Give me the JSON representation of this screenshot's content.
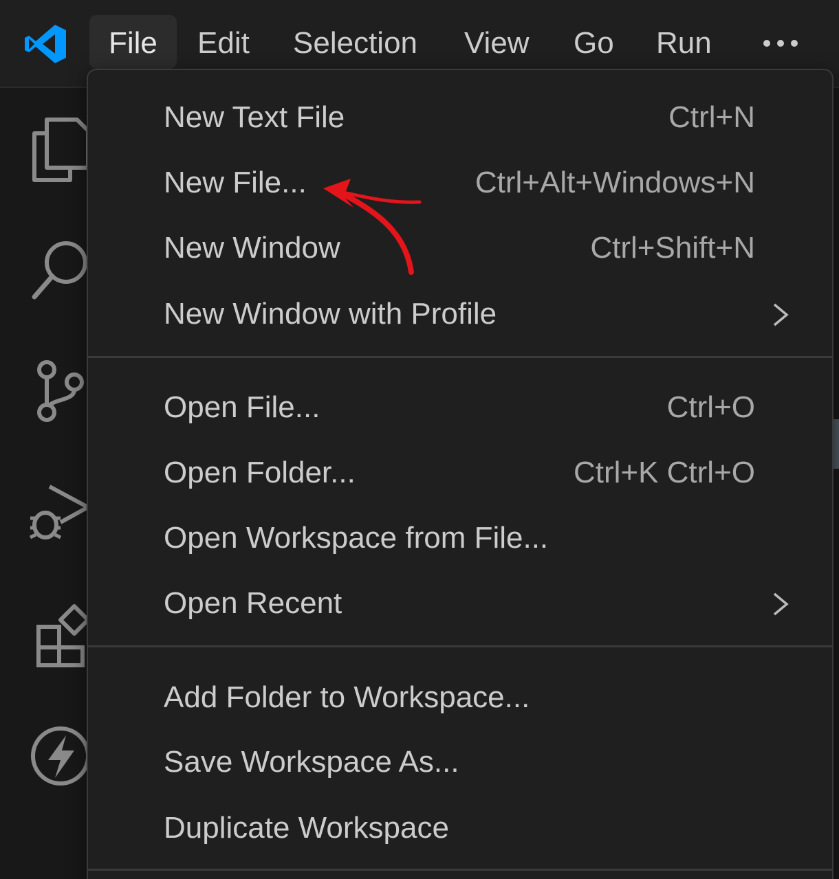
{
  "menubar": {
    "items": [
      {
        "label": "File"
      },
      {
        "label": "Edit"
      },
      {
        "label": "Selection"
      },
      {
        "label": "View"
      },
      {
        "label": "Go"
      },
      {
        "label": "Run"
      }
    ],
    "active": "File",
    "accent_color": "#0098ff"
  },
  "activity_bar": {
    "icons": [
      "explorer-icon",
      "search-icon",
      "source-control-icon",
      "run-debug-icon",
      "extensions-icon",
      "thunder-client-icon"
    ]
  },
  "file_menu": {
    "groups": [
      {
        "items": [
          {
            "label": "New Text File",
            "shortcut": "Ctrl+N"
          },
          {
            "label": "New File...",
            "shortcut": "Ctrl+Alt+Windows+N"
          },
          {
            "label": "New Window",
            "shortcut": "Ctrl+Shift+N"
          },
          {
            "label": "New Window with Profile",
            "shortcut": "",
            "submenu": true
          }
        ]
      },
      {
        "items": [
          {
            "label": "Open File...",
            "shortcut": "Ctrl+O"
          },
          {
            "label": "Open Folder...",
            "shortcut": "Ctrl+K Ctrl+O"
          },
          {
            "label": "Open Workspace from File...",
            "shortcut": ""
          },
          {
            "label": "Open Recent",
            "shortcut": "",
            "submenu": true
          }
        ]
      },
      {
        "items": [
          {
            "label": "Add Folder to Workspace...",
            "shortcut": ""
          },
          {
            "label": "Save Workspace As...",
            "shortcut": ""
          },
          {
            "label": "Duplicate Workspace",
            "shortcut": ""
          }
        ]
      }
    ]
  },
  "annotation": {
    "type": "arrow",
    "color": "#e3151a",
    "points_to": "New File..."
  }
}
